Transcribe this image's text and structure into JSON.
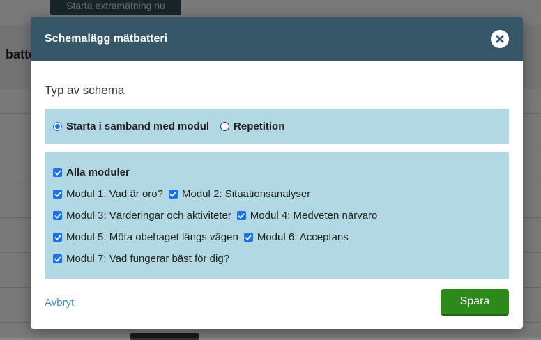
{
  "background": {
    "top_button_label": "Starta extramätning nu",
    "header_fragment": "batte"
  },
  "modal": {
    "title": "Schemalägg mätbatteri",
    "section_title": "Typ av schema",
    "schedule_options": [
      {
        "label": "Starta i samband med modul",
        "checked": true
      },
      {
        "label": "Repetition",
        "checked": false
      }
    ],
    "all_modules": {
      "label": "Alla moduler",
      "checked": true
    },
    "modules": [
      {
        "label": "Modul 1: Vad är oro?",
        "checked": true
      },
      {
        "label": "Modul 2: Situationsanalyser",
        "checked": true
      },
      {
        "label": "Modul 3: Värderingar och aktiviteter",
        "checked": true
      },
      {
        "label": "Modul 4: Medveten närvaro",
        "checked": true
      },
      {
        "label": "Modul 5: Möta obehaget längs vägen",
        "checked": true
      },
      {
        "label": "Modul 6: Acceptans",
        "checked": true
      },
      {
        "label": "Modul 7: Vad fungerar bäst för dig?",
        "checked": true
      }
    ],
    "cancel_label": "Avbryt",
    "save_label": "Spara"
  },
  "colors": {
    "header_bg": "#355767",
    "box_bg": "#b2d9e3",
    "save_bg": "#2d8a1a",
    "link": "#3b8bc0",
    "checkbox": "#1a73e8"
  }
}
